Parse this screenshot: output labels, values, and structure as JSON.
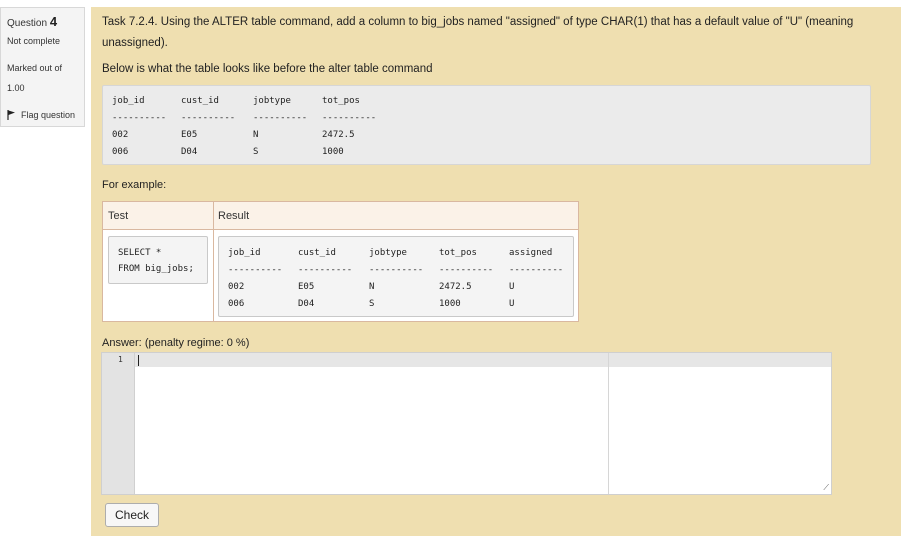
{
  "info": {
    "question_label": "Question",
    "question_number": "4",
    "state": "Not complete",
    "marked_label": "Marked out of",
    "marked_value": "1.00",
    "flag_label": "Flag question"
  },
  "task": {
    "line1": "Task 7.2.4. Using the ALTER table command, add a column to big_jobs named \"assigned\" of type CHAR(1) that has a default value of \"U\" (meaning",
    "line2": "unassigned).",
    "line3": "Below is what the table looks like before the alter table command"
  },
  "before_table": {
    "headers": [
      "job_id",
      "cust_id",
      "jobtype",
      "tot_pos"
    ],
    "separator": "----------",
    "rows": [
      [
        "002",
        "E05",
        "N",
        "2472.5"
      ],
      [
        "006",
        "D04",
        "S",
        "1000"
      ]
    ]
  },
  "examples": {
    "heading": "For example:",
    "col_test": "Test",
    "col_result": "Result",
    "test_lines": [
      "SELECT *",
      "FROM big_jobs;"
    ],
    "result_headers": [
      "job_id",
      "cust_id",
      "jobtype",
      "tot_pos",
      "assigned"
    ],
    "separator": "----------",
    "result_rows": [
      [
        "002",
        "E05",
        "N",
        "2472.5",
        "U"
      ],
      [
        "006",
        "D04",
        "S",
        "1000",
        "U"
      ]
    ]
  },
  "answer": {
    "label": "Answer:",
    "penalty": "(penalty regime: 0 %)",
    "line_number": "1",
    "value": ""
  },
  "check_button": "Check"
}
